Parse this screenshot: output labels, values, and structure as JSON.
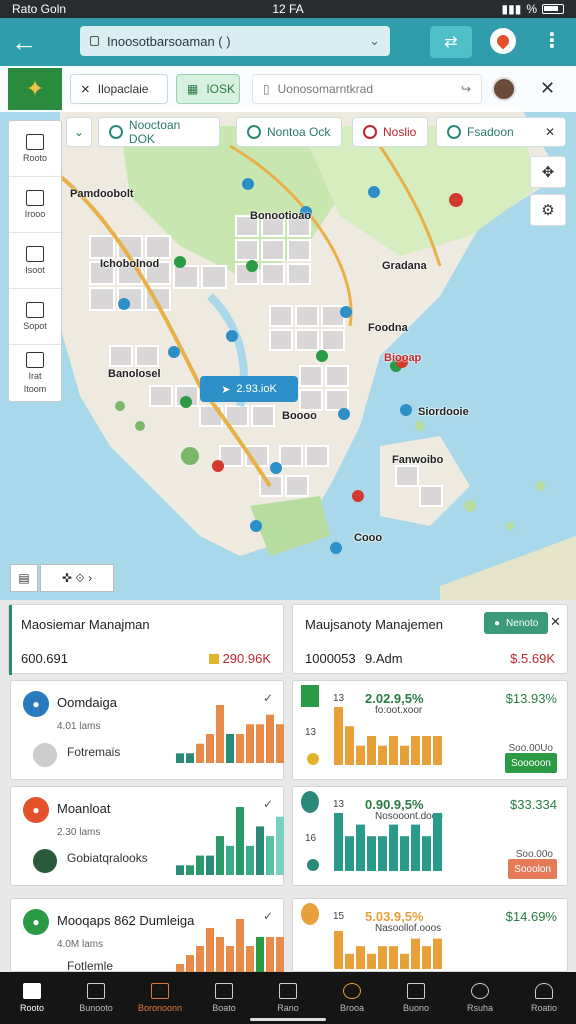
{
  "status": {
    "left": "Rato Goln",
    "center": "12 FA",
    "right": "%"
  },
  "appbar": {
    "url": "Inoosotbarsoaman ( )"
  },
  "topbar": {
    "chip1": "Ilopaclaie",
    "chip2": "IOSK",
    "search_placeholder": "Uonosomarntkrad"
  },
  "filters": [
    {
      "label": "Nooctoan  DOK"
    },
    {
      "label": "Nontoa  Ock"
    },
    {
      "label": "Noslio"
    },
    {
      "label": "Fsadoon"
    }
  ],
  "sidenav": [
    {
      "label": "Rooto"
    },
    {
      "label": "Irooo"
    },
    {
      "label": "Isoot"
    },
    {
      "label": "Sopot"
    },
    {
      "label": "Irat"
    },
    {
      "label": "Itoom"
    }
  ],
  "map_labels": [
    "Pamdoobolt",
    "Ichobolnod",
    "Bonootioao",
    "Gradana",
    "Foodna",
    "Biooap",
    "Banolosel",
    "Siordooie",
    "Fanwoibo",
    "Cooo",
    "Boooo"
  ],
  "map_center_chip": "2.93.ioK",
  "summary": [
    {
      "title": "Maosiemar Manajman",
      "value": "600.691",
      "amount": "290.96K"
    },
    {
      "title": "Maujsanoty Manajemen",
      "value": "1000053",
      "value2": "9.Adm",
      "amount": "$.5.69K",
      "pill": "Nenoto"
    }
  ],
  "rows": [
    {
      "name": "Oomdaiga",
      "sub": "4.01 lams",
      "sub2": "Fotremais",
      "color": "#2a7ac0"
    },
    {
      "name": "Moanloat",
      "sub": "2.30 lams",
      "sub2": "Gobiatqralooks",
      "color": "#e2512a"
    },
    {
      "name": "Mooqaps 862 Dumleiga",
      "sub": "4.0M lams",
      "sub2": "Fotlemle",
      "color": "#2a9a44"
    }
  ],
  "stats": [
    {
      "n1": "13",
      "n2": "13",
      "pct": "2.02.9,5%",
      "lbl": "fo:oot.xoor",
      "big": "$13.93%",
      "small": "Soo.00Uo",
      "btn": "Sooooon",
      "btn_color": "#2a9a44"
    },
    {
      "n1": "13",
      "n2": "16",
      "pct": "0.90.9,5%",
      "lbl": "Nosooont.dooo",
      "big": "$33.334",
      "small": "Soo.00o",
      "btn": "Sooolon",
      "btn_color": "#e57a5a"
    },
    {
      "n1": "15",
      "n2": "",
      "pct": "5.03.9,5%",
      "lbl": "Nasoollof.ooos",
      "big": "$14.69%",
      "small": "",
      "btn": "",
      "btn_color": "#2a9a44"
    }
  ],
  "charts": [
    {
      "values": [
        1,
        1,
        2,
        3,
        6,
        3,
        3,
        4,
        4,
        5,
        4
      ],
      "colors": [
        "#2a8a7a",
        "#2a8a7a",
        "#e88a4a",
        "#e88a4a",
        "#e88a4a",
        "#2a8a7a",
        "#e88a4a",
        "#e88a4a",
        "#e88a4a",
        "#e88a4a",
        "#e88a4a"
      ]
    },
    {
      "values": [
        1,
        1,
        2,
        2,
        4,
        3,
        7,
        3,
        5,
        4,
        6
      ],
      "colors": [
        "#2a8a7a",
        "#2a9a6a",
        "#2a9a6a",
        "#2a8a7a",
        "#2a9a6a",
        "#3aaa8a",
        "#2a9a6a",
        "#3aaa8a",
        "#2a8a7a",
        "#5ac0a8",
        "#7ad0c0"
      ]
    },
    {
      "values": [
        1,
        2,
        3,
        5,
        4,
        3,
        6,
        3,
        4,
        4,
        4
      ],
      "colors": [
        "#e88a4a",
        "#e88a4a",
        "#e88a4a",
        "#e88a4a",
        "#e88a4a",
        "#e88a4a",
        "#e88a4a",
        "#e88a4a",
        "#2a9a44",
        "#e88a4a",
        "#e88a4a"
      ]
    },
    {
      "values": [
        6,
        4,
        2,
        3,
        2,
        3,
        2,
        3,
        3,
        3
      ],
      "colors": [
        "#e8a03a",
        "#e8a03a",
        "#e8a03a",
        "#e8a03a",
        "#e8a03a",
        "#e8a03a",
        "#e8a03a",
        "#e8a03a",
        "#e8a03a",
        "#e8a03a"
      ]
    },
    {
      "values": [
        5,
        3,
        4,
        3,
        3,
        4,
        3,
        4,
        3,
        5
      ],
      "colors": [
        "#2a9a8a",
        "#2a9a8a",
        "#2a9a8a",
        "#2a9a8a",
        "#2a9a8a",
        "#2a9a8a",
        "#2a9a8a",
        "#2a9a8a",
        "#2a9a8a",
        "#2a9a8a"
      ]
    },
    {
      "values": [
        5,
        2,
        3,
        2,
        3,
        3,
        2,
        4,
        3,
        4
      ],
      "colors": [
        "#e8a03a",
        "#e8a03a",
        "#e8a03a",
        "#e8a03a",
        "#e8a03a",
        "#e8a03a",
        "#e8a03a",
        "#e8a03a",
        "#e8a03a",
        "#e8a03a"
      ]
    }
  ],
  "bottomnav": [
    {
      "label": "Rooto"
    },
    {
      "label": "Bunooto"
    },
    {
      "label": "Boronoonn"
    },
    {
      "label": "Boato"
    },
    {
      "label": "Rano"
    },
    {
      "label": "Brooa"
    },
    {
      "label": "Buono"
    },
    {
      "label": "Rsuha"
    },
    {
      "label": "Roatio"
    }
  ]
}
